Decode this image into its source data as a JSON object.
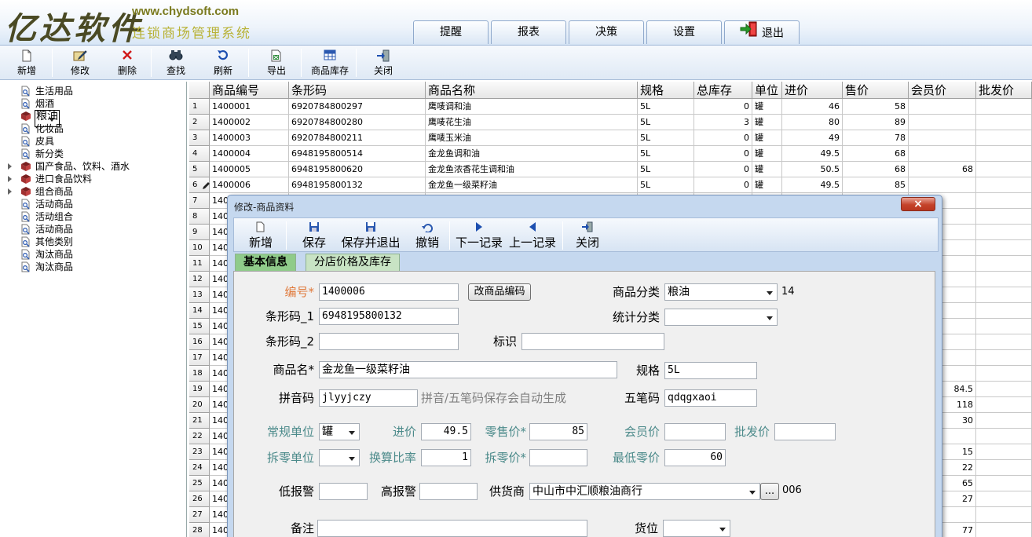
{
  "header": {
    "logo": "亿达软件",
    "url": "www.chydsoft.com",
    "subtitle": "连锁商场管理系统",
    "nav": [
      {
        "label": "提醒"
      },
      {
        "label": "报表"
      },
      {
        "label": "决策"
      },
      {
        "label": "设置"
      },
      {
        "label": "退出"
      }
    ]
  },
  "toolbar": {
    "new": "新增",
    "edit": "修改",
    "delete": "删除",
    "find": "查找",
    "refresh": "刷新",
    "export": "导出",
    "stock": "商品库存",
    "close": "关闭"
  },
  "tree": [
    {
      "label": "生活用品",
      "expandable": false
    },
    {
      "label": "烟酒",
      "expandable": false
    },
    {
      "label": "粮油",
      "expandable": false,
      "selected": true
    },
    {
      "label": "化妆品",
      "expandable": false
    },
    {
      "label": "皮具",
      "expandable": false
    },
    {
      "label": "新分类",
      "expandable": false
    },
    {
      "label": "国产食品、饮料、酒水",
      "expandable": true
    },
    {
      "label": "进口食品饮料",
      "expandable": true
    },
    {
      "label": "组合商品",
      "expandable": true
    },
    {
      "label": "活动商品",
      "expandable": false
    },
    {
      "label": "活动组合",
      "expandable": false
    },
    {
      "label": "活动商品",
      "expandable": false
    },
    {
      "label": "其他类别",
      "expandable": false
    },
    {
      "label": "淘汰商品",
      "expandable": false
    },
    {
      "label": "淘汰商品",
      "expandable": false
    }
  ],
  "grid": {
    "columns": [
      "商品编号",
      "条形码",
      "商品名称",
      "规格",
      "总库存",
      "单位",
      "进价",
      "售价",
      "会员价",
      "批发价"
    ],
    "rows": [
      {
        "n": "1",
        "code": "1400001",
        "barcode": "6920784800297",
        "name": "鹰唛调和油",
        "spec": "5L",
        "stock": "0",
        "unit": "罐",
        "cost": "46",
        "price": "58",
        "member": "",
        "wholesale": ""
      },
      {
        "n": "2",
        "code": "1400002",
        "barcode": "6920784800280",
        "name": "鹰唛花生油",
        "spec": "5L",
        "stock": "3",
        "unit": "罐",
        "cost": "80",
        "price": "89",
        "member": "",
        "wholesale": ""
      },
      {
        "n": "3",
        "code": "1400003",
        "barcode": "6920784800211",
        "name": "鹰唛玉米油",
        "spec": "5L",
        "stock": "0",
        "unit": "罐",
        "cost": "49",
        "price": "78",
        "member": "",
        "wholesale": ""
      },
      {
        "n": "4",
        "code": "1400004",
        "barcode": "6948195800514",
        "name": "金龙鱼调和油",
        "spec": "5L",
        "stock": "0",
        "unit": "罐",
        "cost": "49.5",
        "price": "68",
        "member": "",
        "wholesale": ""
      },
      {
        "n": "5",
        "code": "1400005",
        "barcode": "6948195800620",
        "name": "金龙鱼浓香花生调和油",
        "spec": "5L",
        "stock": "0",
        "unit": "罐",
        "cost": "50.5",
        "price": "68",
        "member": "68",
        "wholesale": ""
      },
      {
        "n": "6",
        "code": "1400006",
        "barcode": "6948195800132",
        "name": "金龙鱼一级菜籽油",
        "spec": "5L",
        "stock": "0",
        "unit": "罐",
        "cost": "49.5",
        "price": "85",
        "member": "",
        "wholesale": ""
      }
    ],
    "more_rows": [
      {
        "n": "7",
        "code": "140",
        "member": ""
      },
      {
        "n": "8",
        "code": "140",
        "member": ""
      },
      {
        "n": "9",
        "code": "140",
        "member": ""
      },
      {
        "n": "10",
        "code": "140",
        "member": ""
      },
      {
        "n": "11",
        "code": "140",
        "member": ""
      },
      {
        "n": "12",
        "code": "140",
        "member": ""
      },
      {
        "n": "13",
        "code": "140",
        "member": ""
      },
      {
        "n": "14",
        "code": "140",
        "member": ""
      },
      {
        "n": "15",
        "code": "140",
        "member": ""
      },
      {
        "n": "16",
        "code": "140",
        "member": ""
      },
      {
        "n": "17",
        "code": "140",
        "member": ""
      },
      {
        "n": "18",
        "code": "140",
        "member": ""
      },
      {
        "n": "19",
        "code": "140",
        "member": "84.5"
      },
      {
        "n": "20",
        "code": "140",
        "member": "118"
      },
      {
        "n": "21",
        "code": "140",
        "member": "30"
      },
      {
        "n": "22",
        "code": "140",
        "member": ""
      },
      {
        "n": "23",
        "code": "140",
        "member": "15"
      },
      {
        "n": "24",
        "code": "140",
        "member": "22"
      },
      {
        "n": "25",
        "code": "140",
        "member": "65"
      },
      {
        "n": "26",
        "code": "140",
        "member": "27"
      },
      {
        "n": "27",
        "code": "140",
        "member": ""
      },
      {
        "n": "28",
        "code": "140",
        "member": "77"
      }
    ]
  },
  "dialog": {
    "title": "修改-商品资料",
    "close": "×",
    "toolbar": {
      "new": "新增",
      "save": "保存",
      "save_exit": "保存并退出",
      "undo": "撤销",
      "next": "下一记录",
      "prev": "上一记录",
      "close": "关闭"
    },
    "tabs": {
      "basic": "基本信息",
      "branch": "分店价格及库存"
    },
    "form": {
      "code_label": "编号*",
      "code": "1400006",
      "change_code_btn": "改商品编码",
      "category_label": "商品分类",
      "category": "粮油",
      "category_id": "14",
      "barcode1_label": "条形码_1",
      "barcode1": "6948195800132",
      "stat_category_label": "统计分类",
      "stat_category": "",
      "barcode2_label": "条形码_2",
      "barcode2": "",
      "tag_label": "标识",
      "tag": "",
      "name_label": "商品名*",
      "name": "金龙鱼一级菜籽油",
      "spec_label": "规格",
      "spec": "5L",
      "pinyin_label": "拼音码",
      "pinyin": "jlyyjczy",
      "pinyin_hint": "拼音/五笔码保存会自动生成",
      "wubi_label": "五笔码",
      "wubi": "qdqgxaoi",
      "unit_label": "常规单位",
      "unit": "罐",
      "cost_label": "进价",
      "cost": "49.5",
      "retail_label": "零售价*",
      "retail": "85",
      "member_label": "会员价",
      "member": "",
      "wholesale_label": "批发价",
      "wholesale": "",
      "split_unit_label": "拆零单位",
      "split_unit": "",
      "ratio_label": "换算比率",
      "ratio": "1",
      "split_price_label": "拆零价*",
      "split_price": "",
      "min_price_label": "最低零价",
      "min_price": "60",
      "low_alert_label": "低报警",
      "low_alert": "",
      "high_alert_label": "高报警",
      "high_alert": "",
      "supplier_label": "供货商",
      "supplier": "中山市中汇顺粮油商行",
      "supplier_btn": "...",
      "supplier_id": "006",
      "note_label": "备注",
      "note": "",
      "location_label": "货位",
      "location": ""
    }
  },
  "colors": {
    "accent": "#c5d8ef",
    "tab_active": "#8fcb8a",
    "label_orange": "#e07a3c",
    "label_teal": "#4b8a8a"
  }
}
